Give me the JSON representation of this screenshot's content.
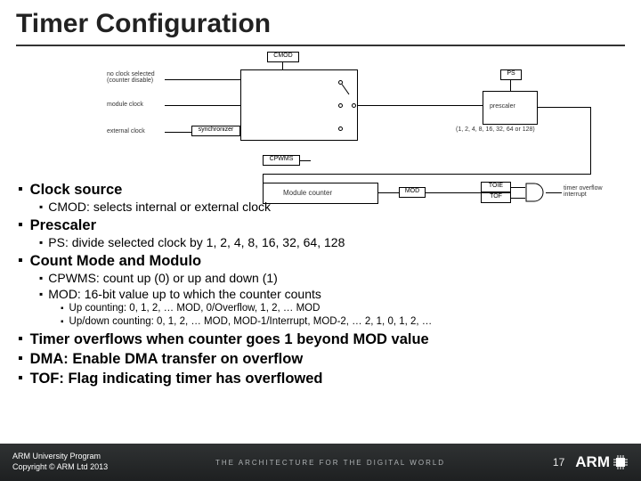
{
  "title": "Timer Configuration",
  "diagram": {
    "labels": {
      "cmod": "CMOD",
      "no_clock": "no clock selected\n(counter disable)",
      "module_clock": "module clock",
      "external_clock": "external clock",
      "synchronizer": "synchronizer",
      "ps": "PS",
      "prescaler": "prescaler",
      "prescaler_opts": "(1, 2, 4, 8, 16, 32, 64 or 128)",
      "cpwms": "CPWMS",
      "module_counter": "Module counter",
      "mod": "MOD",
      "toie": "TOIE",
      "tof": "TOF",
      "timer_overflow": "timer overflow\ninterrupt"
    }
  },
  "bullets": [
    {
      "text": "Clock source",
      "children": [
        {
          "text": "CMOD: selects internal or external clock",
          "narrow": true
        }
      ]
    },
    {
      "text": "Prescaler",
      "children": [
        {
          "text": "PS: divide selected clock by 1, 2, 4, 8, 16, 32, 64, 128"
        }
      ]
    },
    {
      "text": "Count Mode and Modulo",
      "children": [
        {
          "text": "CPWMS: count up (0) or up and down (1)"
        },
        {
          "text": "MOD: 16-bit value up to which the counter counts",
          "children": [
            {
              "text": "Up counting: 0, 1, 2, … MOD, 0/Overflow, 1, 2, … MOD"
            },
            {
              "text": "Up/down counting: 0, 1, 2, … MOD, MOD-1/Interrupt, MOD-2, … 2, 1, 0, 1, 2, …"
            }
          ]
        }
      ]
    },
    {
      "text": "Timer overflows when counter goes 1 beyond MOD value"
    },
    {
      "text": "DMA: Enable DMA transfer on overflow"
    },
    {
      "text": "TOF: Flag indicating timer has overflowed"
    }
  ],
  "footer": {
    "program": "ARM University Program",
    "copyright": "Copyright © ARM Ltd 2013",
    "tagline": "THE ARCHITECTURE FOR THE DIGITAL WORLD",
    "page": "17",
    "logo": "ARM"
  }
}
